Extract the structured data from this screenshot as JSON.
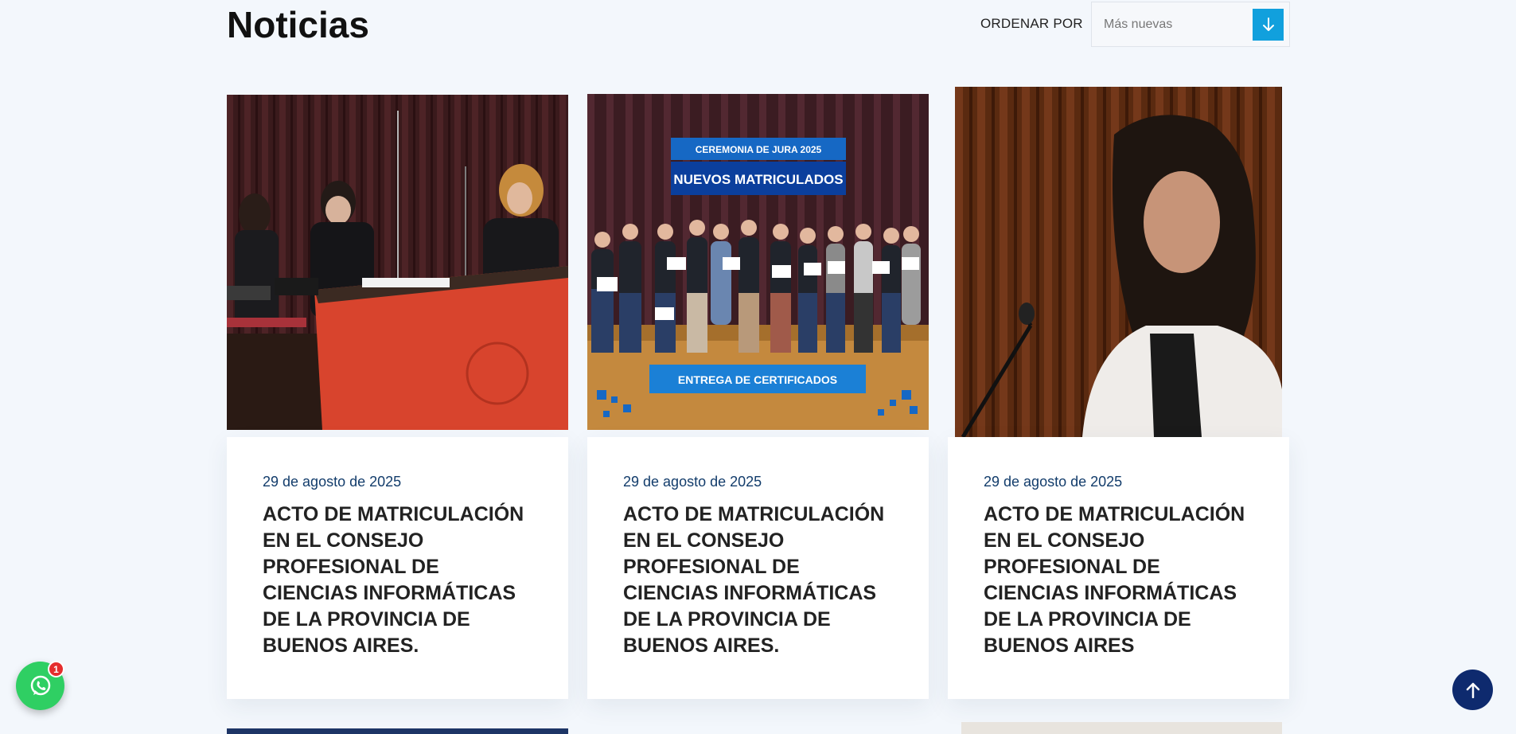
{
  "header": {
    "title": "Noticias",
    "sort_label": "ORDENAR POR",
    "sort_value": "Más nuevas"
  },
  "cards": [
    {
      "date": "29 de agosto de 2025",
      "title": "ACTO DE MATRICULACIÓN EN EL CONSEJO PROFESIONAL DE CIENCIAS INFORMÁTICAS DE LA PROVINCIA DE BUENOS AIRES."
    },
    {
      "date": "29 de agosto de 2025",
      "title": "ACTO DE MATRICULACIÓN EN EL CONSEJO PROFESIONAL DE CIENCIAS INFORMÁTICAS DE LA PROVINCIA DE BUENOS AIRES.",
      "image_banner_top": "CEREMONIA DE JURA 2025",
      "image_banner_main": "NUEVOS MATRICULADOS",
      "image_banner_bottom": "ENTREGA DE CERTIFICADOS"
    },
    {
      "date": "29 de agosto de 2025",
      "title": "ACTO DE MATRICULACIÓN EN EL CONSEJO PROFESIONAL DE CIENCIAS INFORMÁTICAS DE LA PROVINCIA DE BUENOS AIRES"
    }
  ],
  "floating": {
    "whatsapp_badge": "1",
    "whatsapp_icon": "whatsapp-icon",
    "scroll_top_icon": "arrow-up-icon"
  },
  "colors": {
    "background": "#f3f7fc",
    "accent": "#11a0dd",
    "date": "#123c6b",
    "scroll_top": "#0e2a6e",
    "whatsapp": "#2fcf63"
  }
}
